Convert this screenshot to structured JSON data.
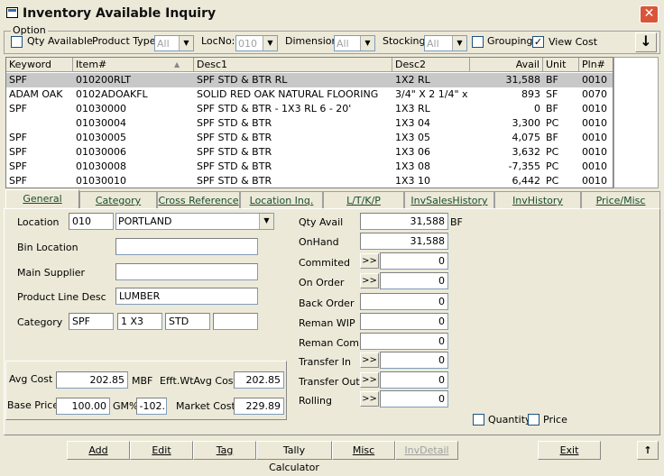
{
  "window": {
    "title": "Inventory Available Inquiry"
  },
  "option": {
    "legend": "Option",
    "qty_available_label": "Qty Available",
    "product_type_label": "Product Type:",
    "product_type_value": "All",
    "locno_label": "LocNo:",
    "locno_value": "010",
    "dimension_label": "Dimension:",
    "dimension_value": "All",
    "stocking_label": "Stocking:",
    "stocking_value": "All",
    "grouping_label": "Grouping",
    "view_cost_label": "View Cost",
    "view_cost_checked": "✓"
  },
  "grid": {
    "headers": [
      "Keyword",
      "Item#",
      "Desc1",
      "Desc2",
      "Avail",
      "Unit",
      "Pln#"
    ],
    "sort_indicator": "▲",
    "rows": [
      [
        "SPF",
        "010200RLT",
        "SPF STD & BTR RL",
        "1X2 RL",
        "31,588",
        "BF",
        "0010"
      ],
      [
        "ADAM OAK",
        "0102ADOAKFL",
        "SOLID RED OAK NATURAL FLOORING",
        "3/4\" X 2 1/4\" x",
        "893",
        "SF",
        "0070"
      ],
      [
        "SPF",
        "01030000",
        "SPF STD & BTR - 1X3 RL 6 - 20'",
        "1X3 RL",
        "0",
        "BF",
        "0010"
      ],
      [
        "",
        "01030004",
        "SPF STD & BTR",
        "1X3 04",
        "3,300",
        "PC",
        "0010"
      ],
      [
        "SPF",
        "01030005",
        "SPF STD & BTR",
        "1X3 05",
        "4,075",
        "BF",
        "0010"
      ],
      [
        "SPF",
        "01030006",
        "SPF STD & BTR",
        "1X3 06",
        "3,632",
        "PC",
        "0010"
      ],
      [
        "SPF",
        "01030008",
        "SPF STD & BTR",
        "1X3 08",
        "-7,355",
        "PC",
        "0010"
      ],
      [
        "SPF",
        "01030010",
        "SPF STD & BTR",
        "1X3 10",
        "6,442",
        "PC",
        "0010"
      ]
    ]
  },
  "tabs": [
    "General",
    "Category",
    "Cross Reference",
    "Location Inq.",
    "L/T/K/P",
    "InvSalesHistory",
    "InvHistory",
    "Price/Misc"
  ],
  "general": {
    "location_label": "Location",
    "location_code": "010",
    "location_name": "PORTLAND",
    "bin_location_label": "Bin Location",
    "bin_location_value": "",
    "main_supplier_label": "Main Supplier",
    "main_supplier_value": "",
    "product_line_label": "Product Line Desc",
    "product_line_value": "LUMBER",
    "category_label": "Category",
    "category_values": [
      "SPF",
      "1 X3",
      "STD",
      ""
    ],
    "avg_cost_label": "Avg Cost",
    "avg_cost_value": "202.85",
    "avg_cost_unit": "MBF",
    "efft_label": "Efft.WtAvg Cost",
    "efft_value": "202.85",
    "base_price_label": "Base Price",
    "base_price_value": "100.00",
    "gm_label": "GM%",
    "gm_value": "-102.",
    "market_cost_label": "Market Cost",
    "market_cost_value": "229.89"
  },
  "qty": {
    "qty_avail_label": "Qty Avail",
    "qty_avail_value": "31,588",
    "qty_avail_unit": "BF",
    "onhand_label": "OnHand",
    "onhand_value": "31,588",
    "rows": [
      {
        "label": "Commited",
        "value": "0",
        "button": ">>"
      },
      {
        "label": "On Order",
        "value": "0",
        "button": ">>"
      },
      {
        "label": "Back Order",
        "value": "0",
        "button": ""
      },
      {
        "label": "Reman WIP",
        "value": "0",
        "button": ""
      },
      {
        "label": "Reman Comm",
        "value": "0",
        "button": ""
      },
      {
        "label": "Transfer In",
        "value": "0",
        "button": ">>"
      },
      {
        "label": "Transfer Out",
        "value": "0",
        "button": ">>"
      },
      {
        "label": "Rolling",
        "value": "0",
        "button": ">>"
      }
    ],
    "quantity_label": "Quantity",
    "price_label": "Price"
  },
  "bottom": {
    "add": "Add",
    "edit": "Edit",
    "tag": "Tag",
    "tally": "Tally Calculator",
    "misc": "Misc",
    "invdetail": "InvDetail",
    "exit": "Exit"
  }
}
